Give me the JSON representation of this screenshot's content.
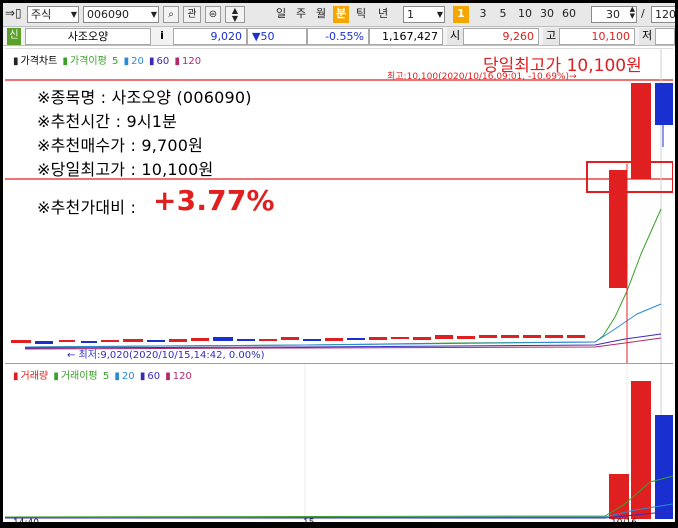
{
  "toolbar": {
    "market_select": "주식",
    "code_input": "006090",
    "search_icon": "search-icon",
    "gwan_button": "관",
    "period_tabs": [
      "일",
      "주",
      "월",
      "분",
      "틱",
      "년"
    ],
    "active_period": "분",
    "interval_value": "1",
    "interval_buttons": [
      "1",
      "3",
      "5",
      "10",
      "30",
      "60"
    ],
    "active_interval": "1",
    "count_value": "30",
    "slash": "/",
    "total_value": "120"
  },
  "quote": {
    "badge": "신",
    "name": "사조오양",
    "info_btn": "i",
    "price": "9,020",
    "change": "▼50",
    "change_pct": "-0.55%",
    "volume": "1,167,427",
    "open_label": "시",
    "open_value": "9,260",
    "high_label": "고",
    "high_value": "10,100",
    "low_label": "저"
  },
  "price_legend": {
    "prefix": "가격차트",
    "ma_label": "가격이평",
    "ma5": "5",
    "ma20": "20",
    "ma60": "60",
    "ma120": "120"
  },
  "volume_legend": {
    "prefix": "거래량",
    "ma_label": "거래이평",
    "ma5": "5",
    "ma20": "20",
    "ma60": "60",
    "ma120": "120"
  },
  "annotations": {
    "headline": "당일최고가 10,100원",
    "high_marker": "최고:10,100(2020/10/16,09:01, -10.69%)→",
    "low_marker": "← 최저:9,020(2020/10/15,14:42, 0.00%)",
    "stock_name": "※종목명 : 사조오양 (006090)",
    "rec_time": "※추천시간 : 9시1분",
    "rec_price": "※추천매수가 : 9,700원",
    "day_high": "※당일최고가 : 10,100원",
    "vs_rec_label": "※추천가대비 :",
    "vs_rec_value": "+3.77%"
  },
  "xaxis": {
    "left": "14:40",
    "mid": "15",
    "right": "10/16"
  },
  "colors": {
    "up": "#e02020",
    "down": "#1a2fd0",
    "ma5": "#3aa02a",
    "ma20": "#2a8ad8",
    "ma60": "#3a2ab8",
    "ma120": "#b02a6a",
    "accent": "#f6a600"
  }
}
